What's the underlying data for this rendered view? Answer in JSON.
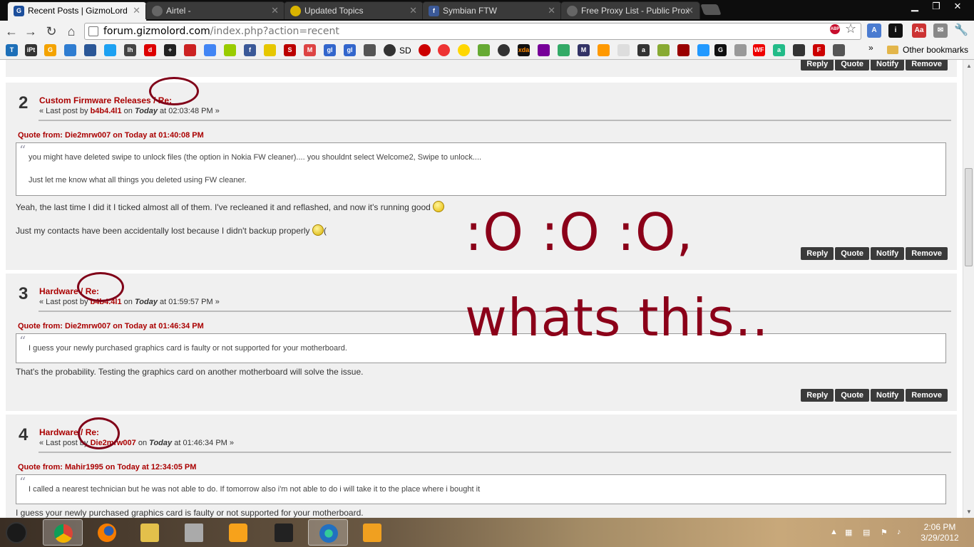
{
  "tabs": [
    {
      "title": "Recent Posts | GizmoLord",
      "active": true
    },
    {
      "title": "Airtel -",
      "active": false
    },
    {
      "title": "Updated Topics",
      "active": false
    },
    {
      "title": "Symbian FTW",
      "active": false
    },
    {
      "title": "Free Proxy List - Public Prox",
      "active": false
    }
  ],
  "address": {
    "host": "forum.gizmolord.com",
    "path": "/index.php?action=recent"
  },
  "bookmarks": {
    "sd_label": "SD",
    "other_label": "Other bookmarks",
    "more": "»"
  },
  "posts": [
    {
      "number": "2",
      "title": "Custom Firmware Releases / Re:",
      "meta_prefix": "« Last post by",
      "author": "b4b4.4l1",
      "meta_on": "on",
      "when_day": "Today",
      "when_time": "at 02:03:48 PM »",
      "quote_header": "Quote from: Die2mrw007 on Today at 01:40:08 PM",
      "quote_lines": [
        "you might have deleted swipe to unlock files (the option in Nokia FW cleaner).... you shouldnt select Welcome2, Swipe to unlock....",
        "Just let me know what all things you deleted using FW cleaner."
      ],
      "body_lines": [
        "Yeah, the last time I did it I ticked almost all of them. I've recleaned it and reflashed, and now it's running good",
        "Just my contacts have been accidentally lost because I didn't backup properly",
        "("
      ]
    },
    {
      "number": "3",
      "title": "Hardware / Re:",
      "meta_prefix": "« Last post by",
      "author": "b4b4.4l1",
      "meta_on": "on",
      "when_day": "Today",
      "when_time": "at 01:59:57 PM »",
      "quote_header": "Quote from: Die2mrw007 on Today at 01:46:34 PM",
      "quote_lines": [
        "I guess your newly purchased graphics card is faulty or not supported for your motherboard."
      ],
      "body_lines": [
        "That's the probability. Testing the graphics card on another motherboard will solve the issue."
      ]
    },
    {
      "number": "4",
      "title": "Hardware / Re:",
      "meta_prefix": "« Last post by",
      "author": "Die2mrw007",
      "meta_on": "on",
      "when_day": "Today",
      "when_time": "at 01:46:34 PM »",
      "quote_header": "Quote from: Mahir1995 on Today at 12:34:05 PM",
      "quote_lines": [
        "I called a nearest technician but he was not able to do. If tomorrow also i'm not able to do i will take it to the place where i bought it"
      ],
      "body_lines": [
        "I guess your newly purchased graphics card is faulty or not supported for your motherboard."
      ]
    }
  ],
  "actions": {
    "reply": "Reply",
    "quote": "Quote",
    "notify": "Notify",
    "remove": "Remove"
  },
  "overlay": {
    "line1": ":O :O :O,",
    "line2": "whats this.."
  },
  "clock": {
    "time": "2:06 PM",
    "date": "3/29/2012"
  },
  "colors": {
    "accent_red": "#a00000",
    "overlay_red": "#8b0019",
    "post_bg": "#f0f0f0",
    "button_bg": "#3a3a3a"
  }
}
